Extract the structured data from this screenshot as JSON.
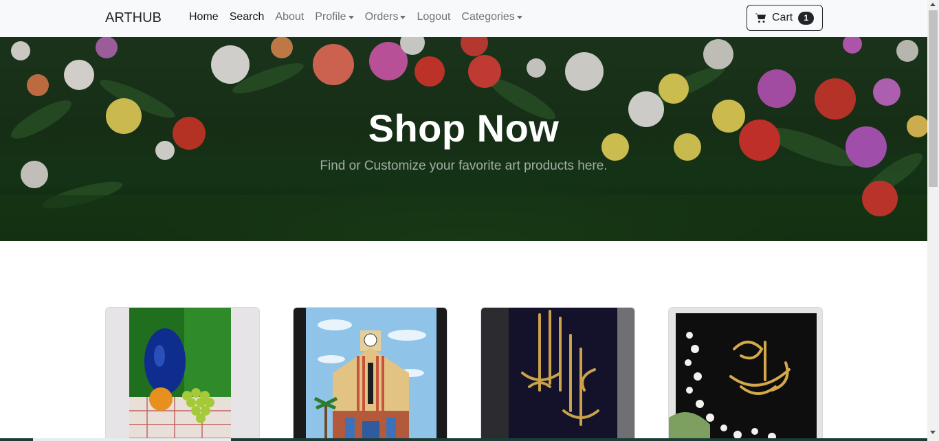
{
  "navbar": {
    "brand": "ARTHUB",
    "items": [
      {
        "label": "Home",
        "dropdown": false,
        "active": true
      },
      {
        "label": "Search",
        "dropdown": false,
        "active": true
      },
      {
        "label": "About",
        "dropdown": false,
        "active": false
      },
      {
        "label": "Profile",
        "dropdown": true,
        "active": false
      },
      {
        "label": "Orders",
        "dropdown": true,
        "active": false
      },
      {
        "label": "Logout",
        "dropdown": false,
        "active": false
      },
      {
        "label": "Categories",
        "dropdown": true,
        "active": false
      }
    ],
    "cart": {
      "label": "Cart",
      "count": "1",
      "icon": "cart-icon"
    }
  },
  "hero": {
    "title": "Shop Now",
    "subtitle": "Find or Customize your favorite art products here."
  },
  "products": [
    {
      "name": "still-life-painting"
    },
    {
      "name": "clock-tower-painting"
    },
    {
      "name": "calligraphy-basmala"
    },
    {
      "name": "calligraphy-muhammad"
    }
  ],
  "colors": {
    "navbar_bg": "#f8f9fa",
    "text_dark": "#212529",
    "hero_title": "#ffffff"
  }
}
